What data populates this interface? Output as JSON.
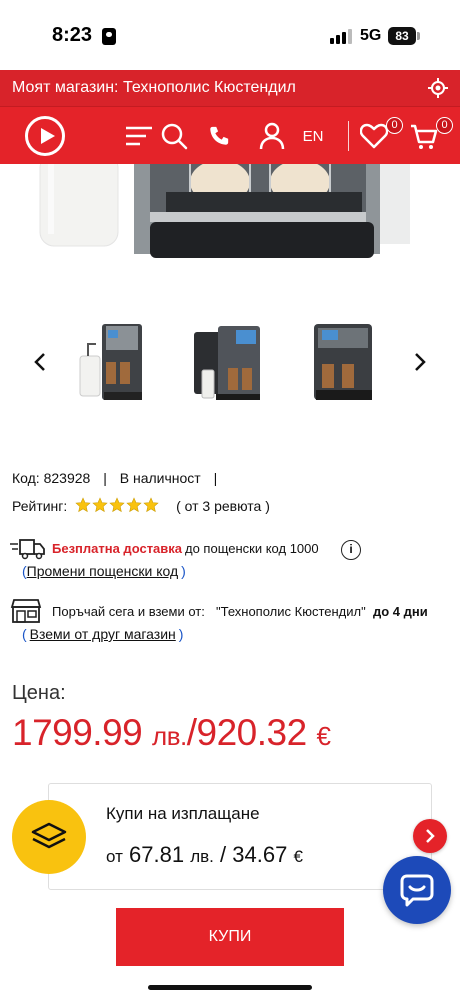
{
  "status_bar": {
    "time": "8:23",
    "network": "5G",
    "battery": "83"
  },
  "store_bar": {
    "text": "Моят магазин: Технополис Кюстендил"
  },
  "nav": {
    "lang": "EN",
    "wishlist_count": "0",
    "cart_count": "0"
  },
  "product": {
    "code": "Код: 823928",
    "sep1": "|",
    "availability": "В наличност",
    "sep2": "|",
    "rating_label": "Рейтинг:",
    "rating_stars": 5,
    "reviews": "( от 3 ревюта )"
  },
  "delivery": {
    "free_label": "Безплатна доставка",
    "postcode_text": "до пощенски код 1000",
    "info": "i",
    "change_paren_open": "(",
    "change_link": "Промени пощенски код",
    "change_paren_close": ")"
  },
  "pickup": {
    "text_prefix": "Поръчай сега и вземи от:",
    "store": "\"Технополис Кюстендил\"",
    "days": "до 4 дни",
    "other_paren_open": "(",
    "other_link": "Вземи от друг магазин",
    "other_paren_close": ")"
  },
  "price": {
    "label": "Цена:",
    "bgn_value": "1799.99",
    "bgn_unit": "лв.",
    "separator": "/",
    "eur_value": "920.32",
    "eur_unit": "€"
  },
  "installment": {
    "title": "Купи на изплащане",
    "prefix": "от",
    "bgn_value": "67.81",
    "bgn_unit": "лв.",
    "separator": "/",
    "eur_value": "34.67",
    "eur_unit": "€"
  },
  "buy_button": {
    "label": "КУПИ"
  },
  "colors": {
    "brand_red": "#e42329",
    "price_red": "#d8232a",
    "accent_yellow": "#f9c20f",
    "chat_blue": "#1d4ab9"
  }
}
